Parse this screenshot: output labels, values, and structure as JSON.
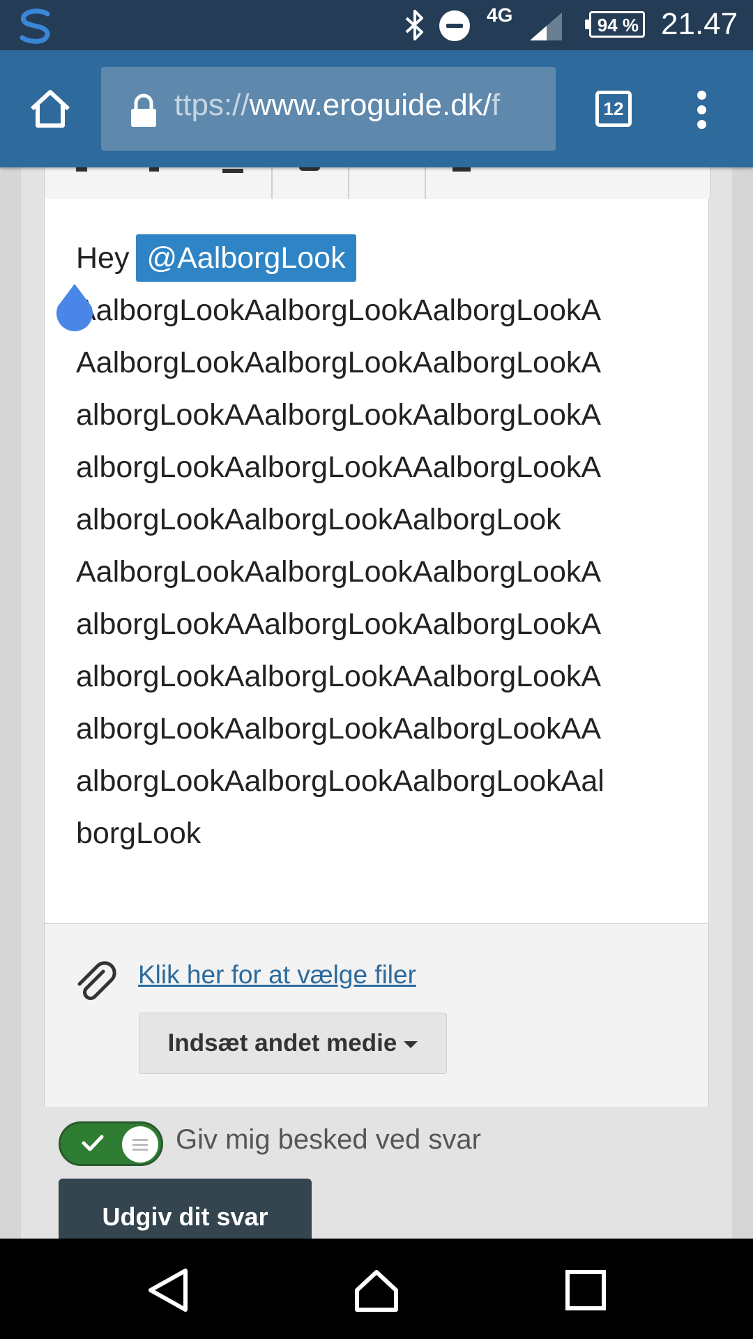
{
  "status_bar": {
    "network": "4G",
    "battery": "94 %",
    "time": "21.47"
  },
  "browser": {
    "url_prefix": "ttps://",
    "url_domain": "www.eroguide.dk/",
    "url_rest": "f",
    "tab_count": "12"
  },
  "editor": {
    "greeting": "Hey",
    "mention": "@AalborgLook",
    "lines": [
      "AalborgLookAalborgLookAalborgLookA",
      "AalborgLookAalborgLookAalborgLookA",
      "alborgLookAAalborgLookAalborgLookA",
      "alborgLookAalborgLookAAalborgLookA",
      "alborgLookAalborgLookAalborgLook",
      "AalborgLookAalborgLookAalborgLookA",
      "alborgLookAAalborgLookAalborgLookA",
      "alborgLookAalborgLookAAalborgLookA",
      "alborgLookAalborgLookAalborgLookAA",
      "alborgLookAalborgLookAalborgLookAal",
      "borgLook"
    ]
  },
  "attachments": {
    "link_label": "Klik her for at vælge filer",
    "media_button_label": "Indsæt andet medie"
  },
  "notify": {
    "label": "Giv mig besked ved svar",
    "enabled": true
  },
  "publish": {
    "label": "Udgiv dit svar"
  },
  "colors": {
    "status_bar": "#243c55",
    "toolbar": "#2f6a9c",
    "mention": "#2f84c6",
    "link": "#2c6a9d",
    "toggle_on": "#2e7d32",
    "publish_button": "#34454f"
  }
}
